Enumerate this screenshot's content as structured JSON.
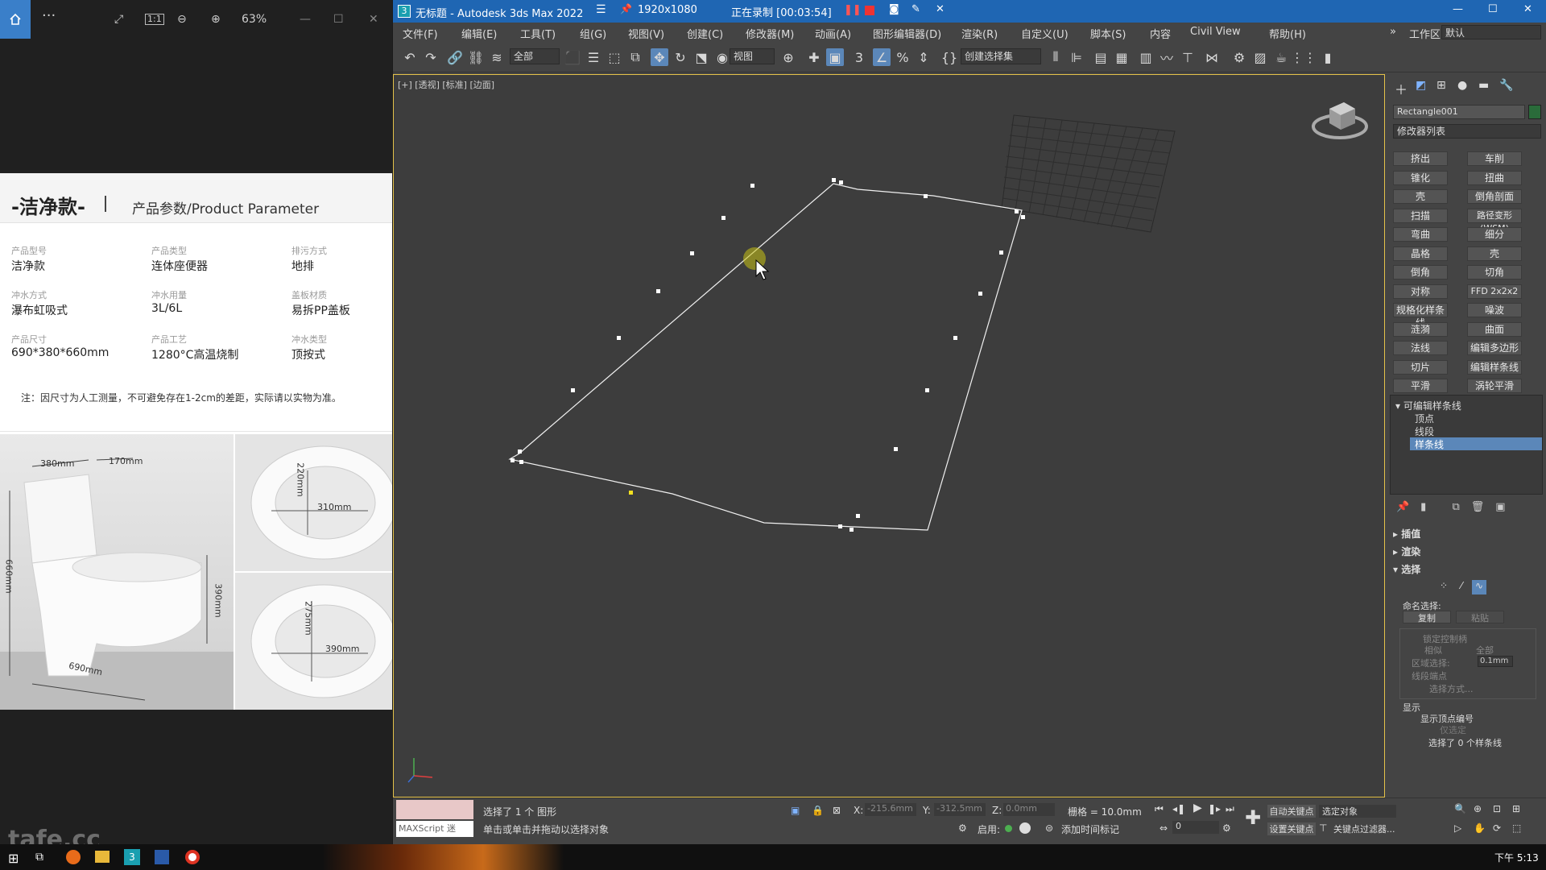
{
  "viewer": {
    "zoom": "63%",
    "doc": {
      "title": "-洁净款-",
      "subtitle": "产品参数/Product Parameter",
      "params": [
        {
          "label": "产品型号",
          "value": "洁净款"
        },
        {
          "label": "产品类型",
          "value": "连体座便器"
        },
        {
          "label": "排污方式",
          "value": "地排"
        },
        {
          "label": "冲水方式",
          "value": "瀑布虹吸式"
        },
        {
          "label": "冲水用量",
          "value": "3L/6L"
        },
        {
          "label": "盖板材质",
          "value": "易拆PP盖板"
        },
        {
          "label": "产品尺寸",
          "value": "690*380*660mm"
        },
        {
          "label": "产品工艺",
          "value": "1280°C高温烧制"
        },
        {
          "label": "冲水类型",
          "value": "顶按式"
        }
      ],
      "note": "注：因尺寸为人工测量，不可避免存在1-2cm的差距，实际请以实物为准。",
      "dims": {
        "d380": "380mm",
        "d170": "170mm",
        "d660": "660mm",
        "d690": "690mm",
        "d390": "390mm",
        "d220": "220mm",
        "d310": "310mm",
        "d275": "275mm",
        "d390b": "390mm"
      }
    },
    "watermark": "tafe.cc"
  },
  "max": {
    "title": "无标题 - Autodesk 3ds Max 2022",
    "rec_res": "1920x1080",
    "rec_status": "正在录制 [00:03:54]",
    "menus": [
      "文件(F)",
      "编辑(E)",
      "工具(T)",
      "组(G)",
      "视图(V)",
      "创建(C)",
      "修改器(M)",
      "动画(A)",
      "图形编辑器(D)",
      "渲染(R)",
      "自定义(U)",
      "脚本(S)",
      "内容",
      "Civil View",
      "帮助(H)"
    ],
    "workspace_label": "工作区:",
    "workspace_value": "默认",
    "selection_filter": "全部",
    "ref_coord": "视图",
    "named_sel": "创建选择集",
    "viewport_label": "[+] [透视] [标准] [边面]",
    "object_name": "Rectangle001",
    "modifier_list": "修改器列表",
    "modifier_buttons": [
      [
        "挤出",
        "车削"
      ],
      [
        "锥化",
        "扭曲"
      ],
      [
        "壳",
        "倒角剖面"
      ],
      [
        "扫描",
        "路径变形 (WSM)"
      ],
      [
        "弯曲",
        "细分"
      ],
      [
        "晶格",
        "壳"
      ],
      [
        "倒角",
        "切角"
      ],
      [
        "对称",
        "FFD 2x2x2"
      ],
      [
        "规格化样条线",
        "噪波"
      ],
      [
        "涟漪",
        "曲面"
      ],
      [
        "法线",
        "编辑多边形"
      ],
      [
        "切片",
        "编辑样条线"
      ],
      [
        "平滑",
        "涡轮平滑"
      ]
    ],
    "stack": {
      "root": "可编辑样条线",
      "items": [
        "顶点",
        "线段",
        "样条线"
      ],
      "selected": "样条线"
    },
    "rollouts": [
      "插值",
      "渲染",
      "选择"
    ],
    "sel_panel": {
      "named_sel": "命名选择:",
      "copy": "复制",
      "paste": "粘贴",
      "lock_handles": "锁定控制柄",
      "alike": "相似",
      "all": "全部",
      "area_sel": "区域选择:",
      "area_val": "0.1mm",
      "seg_end": "线段端点",
      "sel_by": "选择方式...",
      "display": "显示",
      "show_vnum": "显示顶点编号",
      "only_sel": "仅选定",
      "status": "选择了 0 个样条线"
    },
    "status": {
      "maxscript": "MAXScript 迷",
      "selected": "选择了 1 个 图形",
      "prompt": "单击或单击并拖动以选择对象",
      "x": "-215.6mm",
      "y": "-312.5mm",
      "z": "0.0mm",
      "grid": "栅格 = 10.0mm",
      "enable": "启用:",
      "add_tag": "添加时间标记",
      "auto_key": "自动关键点",
      "set_key": "设置关键点",
      "sel_obj": "选定对象",
      "key_filter": "关键点过滤器...",
      "frame": "0"
    }
  },
  "taskbar": {
    "time": "下午 5:13"
  }
}
